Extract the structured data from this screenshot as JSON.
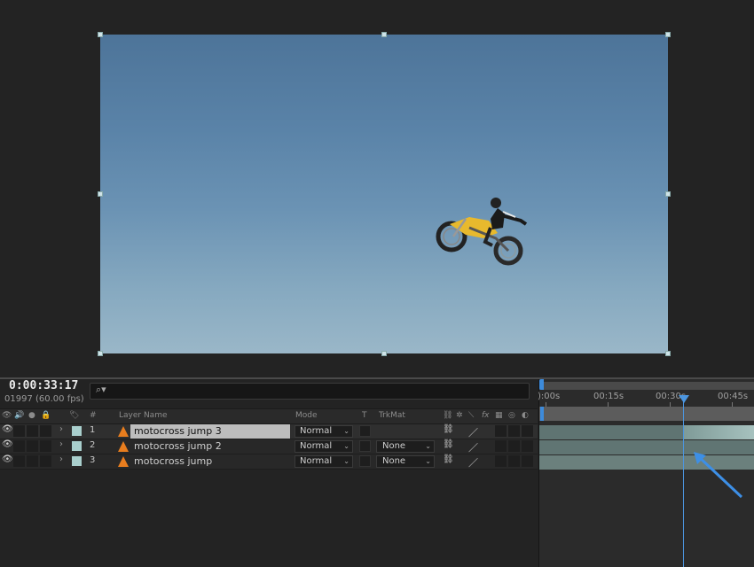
{
  "viewer": {
    "image": "motocross-jump-frame",
    "sky_colors": [
      "#4d7499",
      "#9ab7c8"
    ]
  },
  "timeline": {
    "timecode": "0:00:33:17",
    "frame_info": "01997 (60.00 fps)",
    "search_icon": "search-icon",
    "columns": {
      "num": "#",
      "layer_name": "Layer Name",
      "mode": "Mode",
      "t": "T",
      "trkmat": "TrkMat",
      "fx": "fx"
    },
    "layers": [
      {
        "num": "1",
        "name": "motocross jump 3",
        "mode": "Normal",
        "trkmat": "",
        "selected": true
      },
      {
        "num": "2",
        "name": "motocross jump 2",
        "mode": "Normal",
        "trkmat": "None",
        "selected": false
      },
      {
        "num": "3",
        "name": "motocross jump",
        "mode": "Normal",
        "trkmat": "None",
        "selected": false
      }
    ],
    "ruler": [
      "):00s",
      "00:15s",
      "00:30s",
      "00:45s"
    ],
    "colors": {
      "accent": "#4c96e0",
      "layer_label": "#a9cfcd",
      "layer_bar": "#6b807d",
      "cone": "#e87d1e"
    }
  }
}
